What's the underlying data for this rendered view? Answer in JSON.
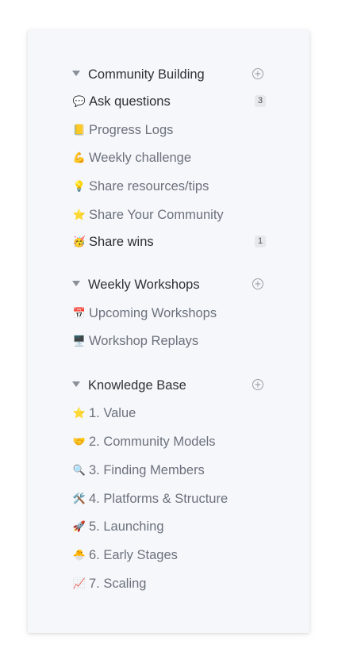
{
  "sections": [
    {
      "title": "Community Building",
      "items": [
        {
          "emoji": "💬",
          "label": "Ask questions",
          "badge": "3",
          "unread": true
        },
        {
          "emoji": "📒",
          "label": "Progress Logs"
        },
        {
          "emoji": "💪",
          "label": "Weekly challenge"
        },
        {
          "emoji": "💡",
          "label": "Share resources/tips"
        },
        {
          "emoji": "⭐",
          "label": "Share Your Community"
        },
        {
          "emoji": "🥳",
          "label": "Share wins",
          "badge": "1",
          "unread": true
        }
      ]
    },
    {
      "title": "Weekly Workshops",
      "items": [
        {
          "emoji": "📅",
          "label": "Upcoming Workshops"
        },
        {
          "emoji": "🖥️",
          "label": "Workshop Replays"
        }
      ]
    },
    {
      "title": "Knowledge Base",
      "items": [
        {
          "emoji": "⭐",
          "label": "1. Value"
        },
        {
          "emoji": "🤝",
          "label": "2. Community Models"
        },
        {
          "emoji": "🔍",
          "label": "3. Finding Members"
        },
        {
          "emoji": "🛠️",
          "label": "4. Platforms & Structure"
        },
        {
          "emoji": "🚀",
          "label": "5. Launching"
        },
        {
          "emoji": "🐣",
          "label": "6. Early Stages"
        },
        {
          "emoji": "📈",
          "label": "7. Scaling"
        }
      ]
    }
  ]
}
